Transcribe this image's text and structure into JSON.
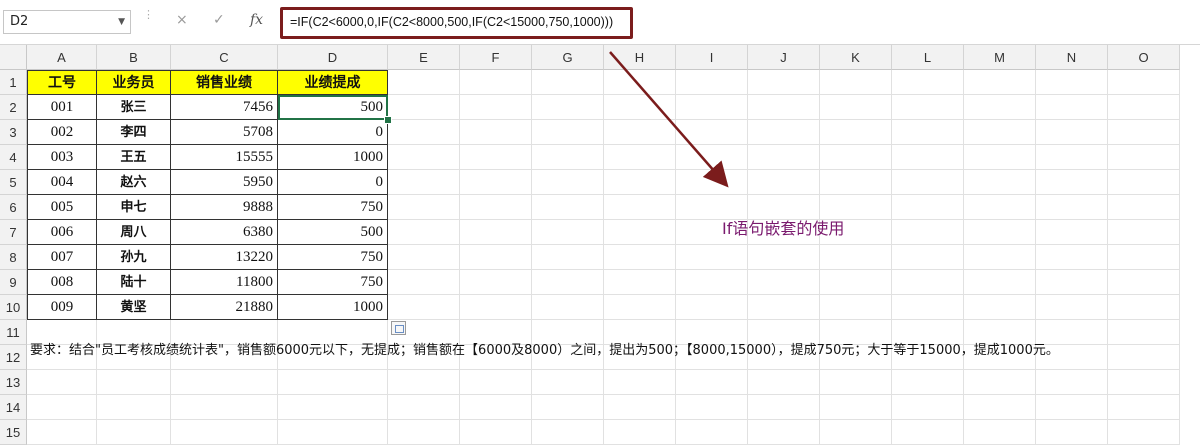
{
  "name_box": "D2",
  "formula_bar": {
    "cancel_icon": "×",
    "confirm_icon": "✓",
    "fx_label": "fx",
    "formula": "=IF(C2<6000,0,IF(C2<8000,500,IF(C2<15000,750,1000)))"
  },
  "columns": [
    "A",
    "B",
    "C",
    "D",
    "E",
    "F",
    "G",
    "H",
    "I",
    "J",
    "K",
    "L",
    "M",
    "N",
    "O"
  ],
  "rows": [
    "1",
    "2",
    "3",
    "4",
    "5",
    "6",
    "7",
    "8",
    "9",
    "10",
    "11",
    "12",
    "13",
    "14",
    "15"
  ],
  "table": {
    "headers": [
      "工号",
      "业务员",
      "销售业绩",
      "业绩提成"
    ],
    "records": [
      [
        "001",
        "张三",
        "7456",
        "500"
      ],
      [
        "002",
        "李四",
        "5708",
        "0"
      ],
      [
        "003",
        "王五",
        "15555",
        "1000"
      ],
      [
        "004",
        "赵六",
        "5950",
        "0"
      ],
      [
        "005",
        "申七",
        "9888",
        "750"
      ],
      [
        "006",
        "周八",
        "6380",
        "500"
      ],
      [
        "007",
        "孙九",
        "13220",
        "750"
      ],
      [
        "008",
        "陆十",
        "11800",
        "750"
      ],
      [
        "009",
        "黄坚",
        "21880",
        "1000"
      ]
    ]
  },
  "annotation": "If语句嵌套的使用",
  "note": "要求：结合\"员工考核成绩统计表\"，销售额6000元以下，无提成；销售额在【6000及8000）之间，提出为500；【8000,15000），提成750元；大于等于15000，提成1000元。",
  "colors": {
    "header_fill": "#ffff00",
    "formula_highlight": "#7b1c1c",
    "arrow": "#7b1c1c",
    "annotation": "#7a1a6e",
    "selection": "#217346"
  }
}
